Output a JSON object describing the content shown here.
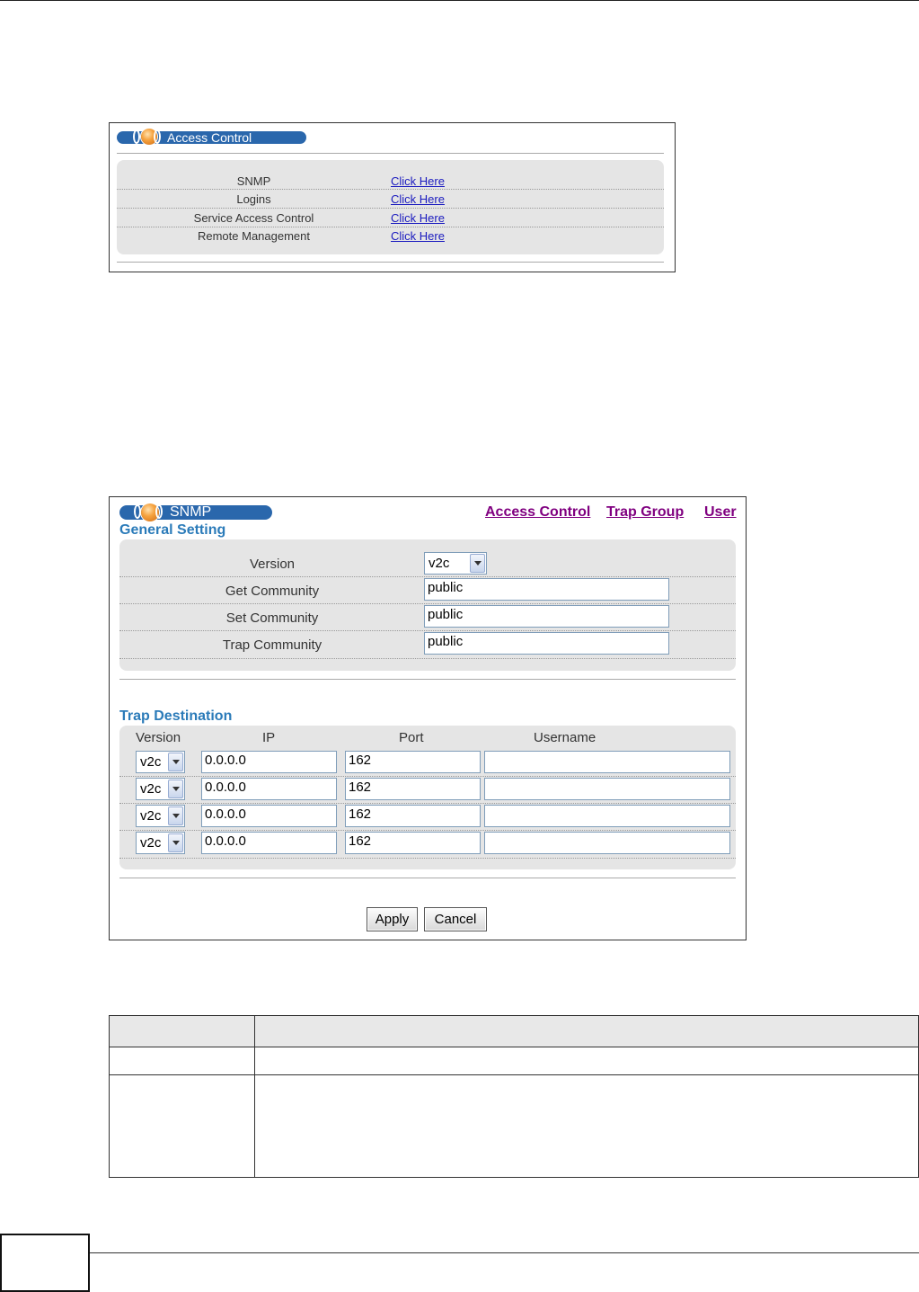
{
  "access_control": {
    "title": "Access Control",
    "rows": [
      {
        "label": "SNMP",
        "link": "Click Here"
      },
      {
        "label": "Logins",
        "link": "Click Here"
      },
      {
        "label": "Service Access Control",
        "link": "Click Here"
      },
      {
        "label": "Remote Management",
        "link": "Click Here"
      }
    ]
  },
  "snmp": {
    "title": "SNMP",
    "nav": [
      "Access Control",
      "Trap Group",
      "User"
    ],
    "general_title": "General Setting",
    "general": {
      "version_label": "Version",
      "version_value": "v2c",
      "get_label": "Get Community",
      "get_value": "public",
      "set_label": "Set Community",
      "set_value": "public",
      "trap_label": "Trap Community",
      "trap_value": "public"
    },
    "trap_title": "Trap Destination",
    "trap_headers": [
      "Version",
      "IP",
      "Port",
      "Username"
    ],
    "trap_rows": [
      {
        "version": "v2c",
        "ip": "0.0.0.0",
        "port": "162",
        "username": ""
      },
      {
        "version": "v2c",
        "ip": "0.0.0.0",
        "port": "162",
        "username": ""
      },
      {
        "version": "v2c",
        "ip": "0.0.0.0",
        "port": "162",
        "username": ""
      },
      {
        "version": "v2c",
        "ip": "0.0.0.0",
        "port": "162",
        "username": ""
      }
    ],
    "apply_label": "Apply",
    "cancel_label": "Cancel"
  },
  "colors": {
    "pill_blue": "#2a67ac",
    "link_blue": "#1a1abf",
    "nav_purple": "#800080",
    "section_blue": "#2b7bb9"
  }
}
